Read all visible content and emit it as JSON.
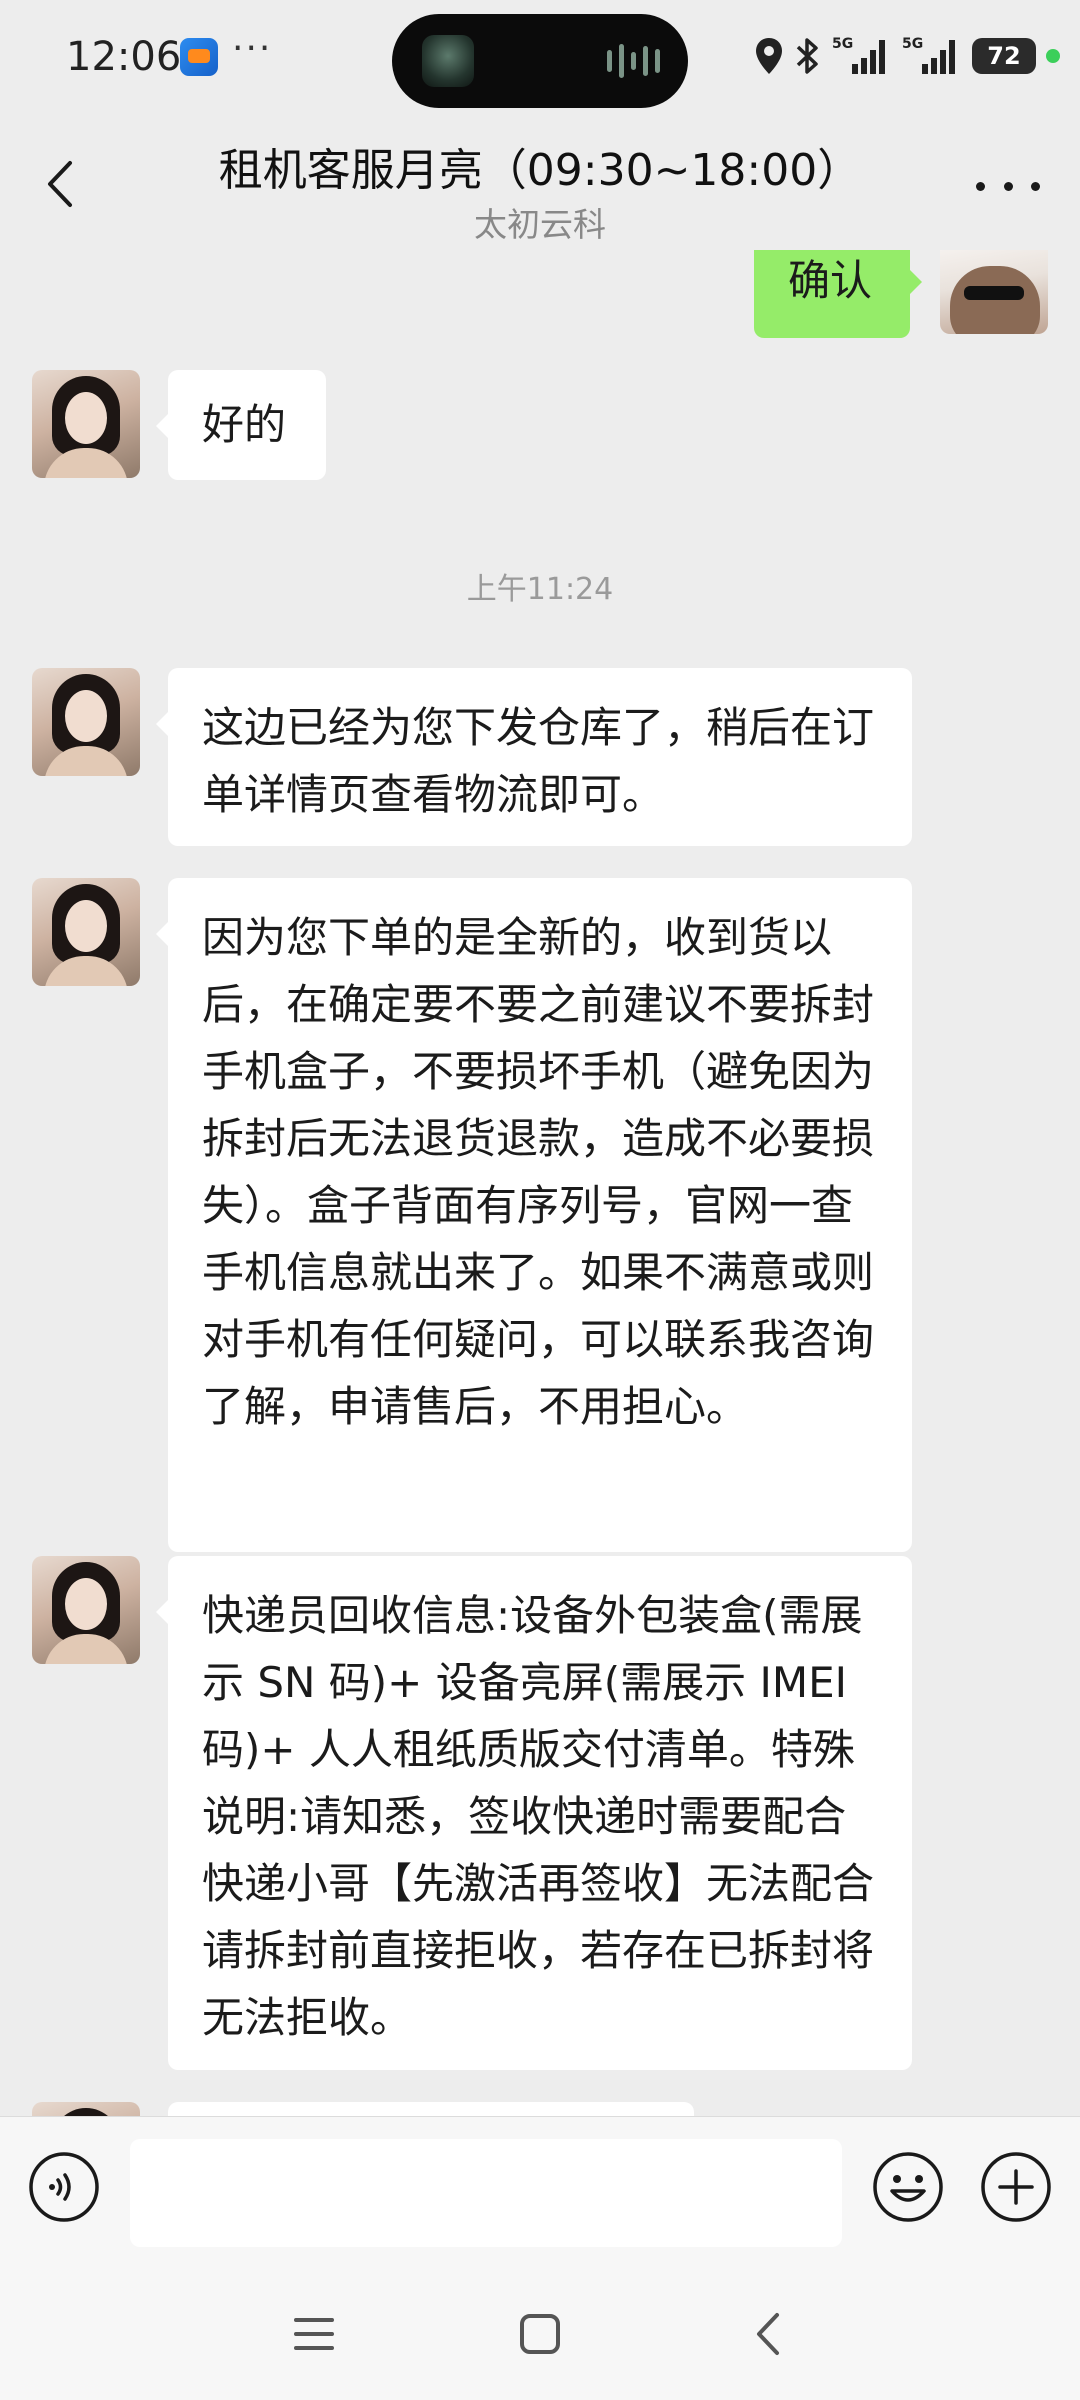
{
  "status_bar": {
    "time": "12:06",
    "overflow_dots": "···",
    "network_1": "5G",
    "network_2": "5G",
    "battery": "72",
    "charging_color": "#3ccf5a"
  },
  "header": {
    "title": "租机客服月亮（09:30~18:00）",
    "subtitle": "太初云科",
    "back_icon": "chevron-left-icon",
    "more_icon": "more-horizontal-icon"
  },
  "messages": [
    {
      "side": "right",
      "text": "确认",
      "sender": "self"
    },
    {
      "side": "left",
      "text": "好的",
      "sender": "agent"
    },
    {
      "type": "time",
      "text": "上午11:24"
    },
    {
      "side": "left",
      "text": "这边已经为您下发仓库了，稍后在订单详情页查看物流即可。",
      "sender": "agent"
    },
    {
      "side": "left",
      "text": "因为您下单的是全新的，收到货以后，在确定要不要之前建议不要拆封手机盒子，不要损坏手机（避免因为拆封后无法退货退款，造成不必要损失）。盒子背面有序列号，官网一查手机信息就出来了。如果不满意或则对手机有任何疑问，可以联系我咨询了解，申请售后，不用担心。",
      "sender": "agent"
    },
    {
      "side": "left",
      "text": "快递员回收信息:设备外包装盒(需展示 SN 码)+ 设备亮屏(需展示 IMEI码)+ 人人租纸质版交付清单。特殊说明:请知悉，签收快递时需要配合快递小哥【先激活再签收】无法配合请拆封前直接拒收，若存在已拆封将无法拒收。",
      "sender": "agent"
    }
  ],
  "input_bar": {
    "voice_icon": "voice-icon",
    "emoji_icon": "emoji-icon",
    "plus_icon": "plus-icon",
    "input_value": ""
  },
  "system_nav": {
    "menu_icon": "menu-icon",
    "home_icon": "home-square-icon",
    "back_icon": "back-triangle-icon"
  },
  "colors": {
    "background": "#ededed",
    "self_bubble": "#95ec69",
    "other_bubble": "#ffffff"
  }
}
